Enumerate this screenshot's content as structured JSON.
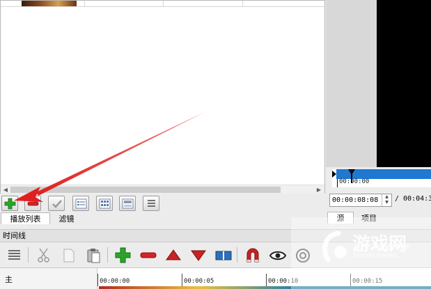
{
  "playlist": {
    "tabs": [
      {
        "label": "播放列表"
      },
      {
        "label": "滤镜"
      }
    ]
  },
  "timeline": {
    "title": "时间线",
    "track_name": "主",
    "ruler": [
      "00:00:00",
      "00:00:05",
      "00:00:10",
      "00:00:15"
    ]
  },
  "player": {
    "scrub_time": "00:00:00",
    "current_timecode": "00:00:08:08",
    "duration": "/ 00:04:3",
    "tabs": [
      {
        "label": "源"
      },
      {
        "label": "项目"
      }
    ]
  },
  "watermark": {
    "brand": "游戏网",
    "sub": "ZHAOYOUXIWANG",
    "url": "xlayx.com"
  },
  "colors": {
    "scrub_bar": "#1f78d1",
    "add_green": "#2aa52a",
    "remove_red": "#d42424",
    "arrow_red": "#e02020"
  }
}
